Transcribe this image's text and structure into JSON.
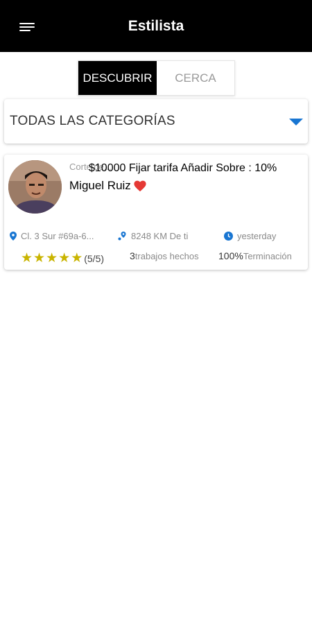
{
  "header": {
    "title": "Estilista",
    "menu_icon": "menu-icon"
  },
  "tabs": [
    {
      "label": "DESCUBRIR",
      "active": true
    },
    {
      "label": "CERCA",
      "active": false
    }
  ],
  "category_dropdown": {
    "selected": "TODAS LAS CATEGORÍAS",
    "icon": "chevron-down-icon",
    "accent": "#1976d2"
  },
  "provider": {
    "category": "Corte de...",
    "price_text": "$10000 Fijar tarifa Añadir Sobre : 10%",
    "name": "Miguel Ruiz",
    "favorite": true,
    "address": "Cl. 3 Sur #69a-6...",
    "distance": "8248 KM De ti",
    "last_seen": "yesterday",
    "rating": 5,
    "rating_text": "(5/5)",
    "jobs_done_count": "3",
    "jobs_done_label": "trabajos hechos",
    "completion_value": "100%",
    "completion_label": "Terminación"
  },
  "colors": {
    "appbar": "#000000",
    "star": "#c9b400",
    "heart": "#e53935",
    "icon_blue": "#1976d2"
  }
}
